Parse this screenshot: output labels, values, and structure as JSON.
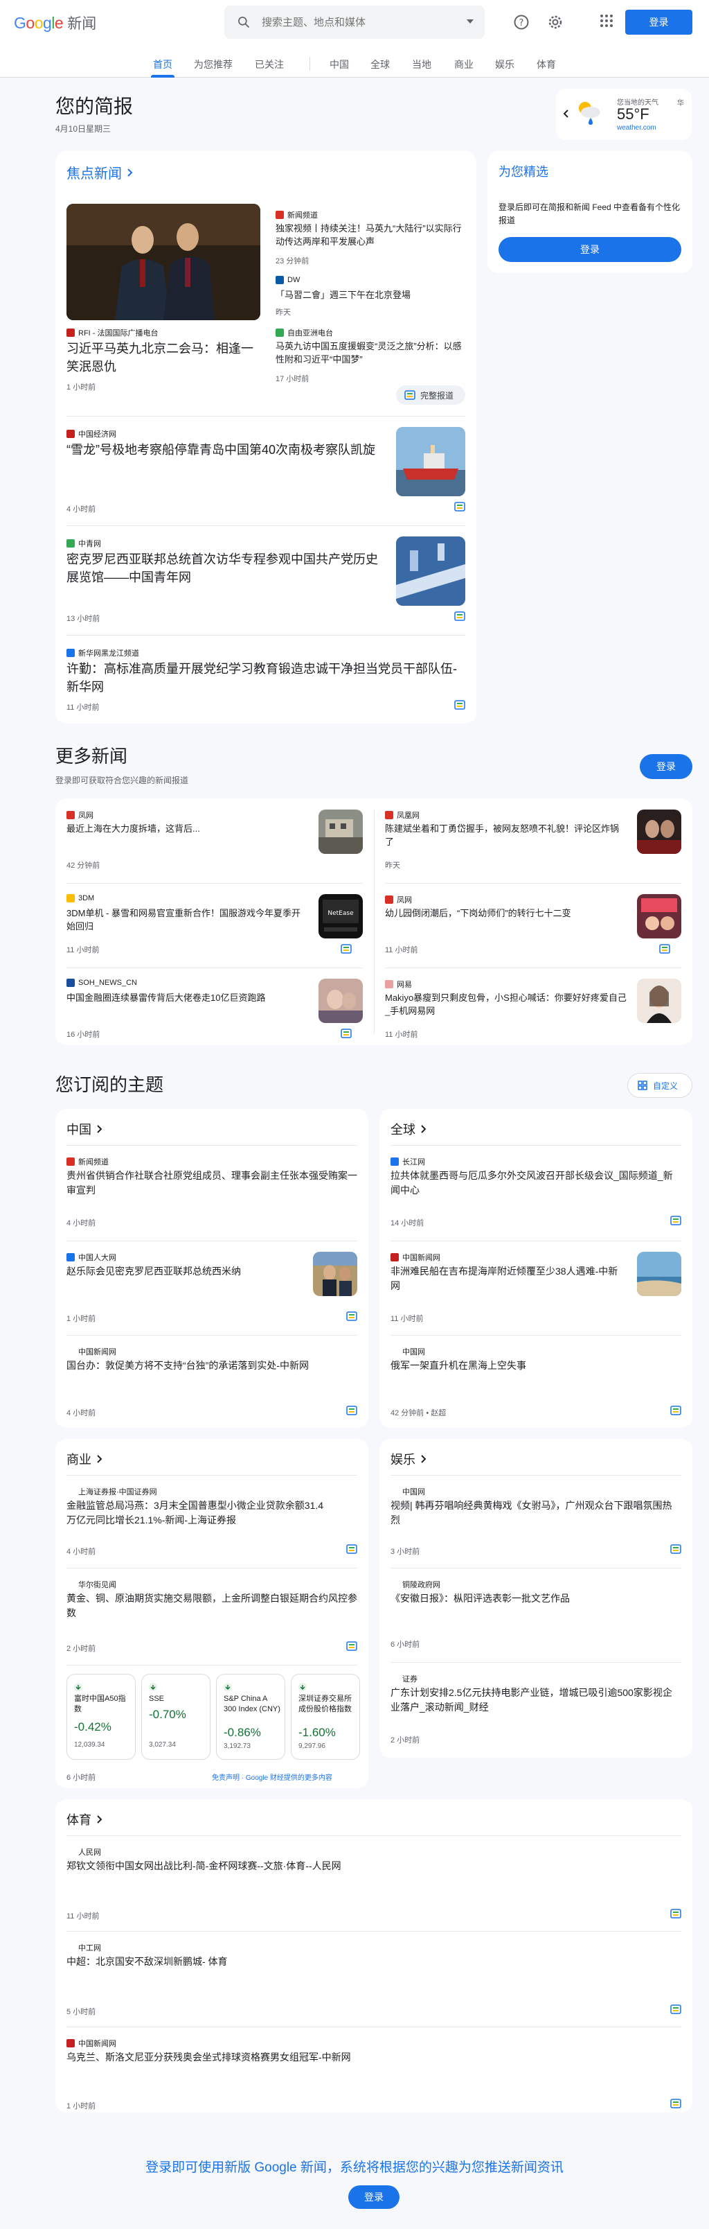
{
  "header": {
    "logo_google": "Google",
    "logo_news": "新闻",
    "search_placeholder": "搜索主题、地点和媒体",
    "signin": "登录"
  },
  "nav": {
    "tabs": [
      "首页",
      "为您推荐",
      "已关注",
      "中国",
      "全球",
      "当地",
      "商业",
      "娱乐",
      "体育"
    ],
    "active": "首页"
  },
  "briefing": {
    "title": "您的简报",
    "date": "4月10日星期三"
  },
  "weather": {
    "label": "您当地的天气",
    "temp": "55°F",
    "source": "weather.com",
    "unit": "华"
  },
  "highlights": {
    "title": "焦点新闻",
    "main": {
      "source": "RFI - 法国国际广播电台",
      "title": "习近平马英九北京二会马：相逢一笑泯恩仇",
      "time": "1 小时前"
    },
    "side": [
      {
        "source": "新闻频道",
        "title": "独家视频丨持续关注！马英九“大陆行”以实际行动传达两岸和平发展心声",
        "time": "23 分钟前"
      },
      {
        "source": "DW",
        "title": "「马習二會」週三下午在北京登場",
        "time": "昨天"
      },
      {
        "source": "自由亚洲电台",
        "title": "马英九访中国五度援蝦变“灵泛之旅”分析：以感性附和习近平“中国梦”",
        "time": "17 小时前"
      }
    ],
    "full_coverage": "完整报道",
    "stories": [
      {
        "source": "中国经济网",
        "title": "“雪龙”号极地考察船停靠青岛中国第40次南极考察队凯旋",
        "time": "4 小时前"
      },
      {
        "source": "中青网",
        "title": "密克罗尼西亚联邦总统首次访华专程参观中国共产党历史展览馆——中国青年网",
        "time": "13 小时前"
      },
      {
        "source": "新华网黑龙江频道",
        "title": "许勤：高标准高质量开展党纪学习教育锻造忠诚干净担当党员干部队伍-新华网",
        "time": "11 小时前"
      }
    ]
  },
  "for_you": {
    "title": "为您精选",
    "text": "登录后即可在简报和新闻 Feed 中查看备有个性化报道",
    "button": "登录"
  },
  "more_news": {
    "title": "更多新闻",
    "subtitle": "登录即可获取符合您兴趣的新闻报道",
    "button": "登录",
    "items": [
      {
        "source": "凤网",
        "title": "最近上海在大力度拆墙，这背后...",
        "time": "42 分钟前"
      },
      {
        "source": "凤凰网",
        "title": "陈建斌坐着和丁勇岱握手，被网友怒喷不礼貌！评论区炸锅了",
        "time": "昨天"
      },
      {
        "source": "3DM",
        "title": "3DM单机 - 暴雪和网易官宣重新合作！国服游戏今年夏季开始回归",
        "time": "11 小时前"
      },
      {
        "source": "凤网",
        "title": "幼儿园倒闭潮后，“下岗幼师们”的转行七十二变",
        "time": "11 小时前"
      },
      {
        "source": "SOH_NEWS_CN",
        "title": "中国金融圈连续暴雷传背后大佬卷走10亿巨资跑路",
        "time": "16 小时前"
      },
      {
        "source": "网易",
        "title": "Makiyo暴瘦到只剩皮包骨，小S担心喊话：你要好好疼爱自己_手机网易网",
        "time": "11 小时前"
      }
    ]
  },
  "topics": {
    "title": "您订阅的主题",
    "customize": "自定义",
    "china": {
      "name": "中国",
      "items": [
        {
          "source": "新闻频道",
          "title": "贵州省供销合作社联合社原党组成员、理事会副主任张本强受贿案一审宣判",
          "time": "4 小时前"
        },
        {
          "source": "中国人大网",
          "title": "赵乐际会见密克罗尼西亚联邦总统西米纳",
          "time": "1 小时前"
        },
        {
          "source": "中国新闻网",
          "title": "国台办：敦促美方将不支持“台独”的承诺落到实处-中新网",
          "time": "4 小时前"
        }
      ]
    },
    "world": {
      "name": "全球",
      "items": [
        {
          "source": "长江网",
          "title": "拉共体就墨西哥与厄瓜多尔外交风波召开部长级会议_国际频道_新闻中心",
          "time": "14 小时前"
        },
        {
          "source": "中国新闻网",
          "title": "非洲难民船在吉布提海岸附近倾覆至少38人遇难-中新网",
          "time": "11 小时前"
        },
        {
          "source": "中国网",
          "title": "俄军一架直升机在黑海上空失事",
          "time": "42 分钟前",
          "extra": "赵超"
        }
      ]
    },
    "business": {
      "name": "商业",
      "items": [
        {
          "source": "上海证券报·中国证券网",
          "title": "金融监管总局冯燕：3月末全国普惠型小微企业贷款余额31.4万亿元同比增长21.1%-新闻-上海证券报",
          "time": "4 小时前"
        },
        {
          "source": "华尔街见闻",
          "title": "黄金、铜、原油期货实施交易限额，上金所调整白银延期合约风控参数",
          "time": "2 小时前"
        }
      ],
      "markets": [
        {
          "name": "富时中国A50指数",
          "pct": "-0.42%",
          "value": "12,039.34"
        },
        {
          "name": "SSE",
          "pct": "-0.70%",
          "value": "3,027.34"
        },
        {
          "name": "S&P China A 300 Index (CNY)",
          "pct": "-0.86%",
          "value": "3,192.73"
        },
        {
          "name": "深圳证券交易所成份股价格指数",
          "pct": "-1.60%",
          "value": "9,297.96"
        }
      ],
      "market_time": "6 小时前",
      "disclaimer": "免责声明 · Google 财经提供的更多内容"
    },
    "entertainment": {
      "name": "娱乐",
      "items": [
        {
          "source": "中国网",
          "title": "视频| 韩再芬唱响经典黄梅戏《女驸马》，广州观众台下跟唱氛围热烈",
          "time": "3 小时前"
        },
        {
          "source": "铜陵政府网",
          "title": "《安徽日报》：枞阳评选表彰一批文艺作品",
          "time": "6 小时前"
        },
        {
          "source": "证券",
          "title": "广东计划安排2.5亿元扶持电影产业链，增城已吸引逾500家影视企业落户_滚动新闻_财经",
          "time": "2 小时前"
        }
      ]
    },
    "sports": {
      "name": "体育",
      "items": [
        {
          "source": "人民网",
          "title": "郑钦文领衔中国女网出战比利-简-金杯网球赛--文旅·体育--人民网",
          "time": "11 小时前"
        },
        {
          "source": "中工网",
          "title": "中超：北京国安不敌深圳新鹏城- 体育",
          "time": "5 小时前"
        },
        {
          "source": "中国新闻网",
          "title": "乌克兰、斯洛文尼亚分获残奥会坐式排球资格赛男女组冠军-中新网",
          "time": "1 小时前"
        }
      ]
    }
  },
  "footer": {
    "text": "登录即可使用新版 Google 新闻，系统将根据您的兴趣为您推送新闻资讯",
    "button": "登录"
  }
}
